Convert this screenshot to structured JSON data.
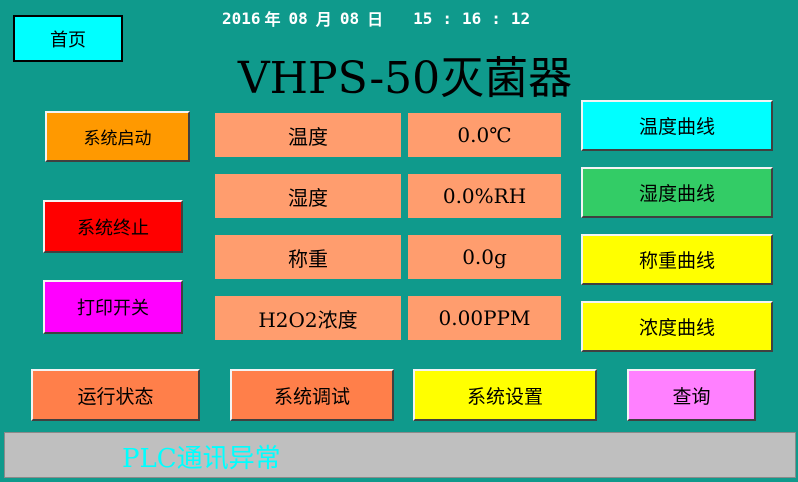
{
  "header": {
    "home_label": "首页",
    "date": {
      "year": "2016",
      "year_unit": "年",
      "month": "08",
      "month_unit": "月",
      "day": "08",
      "day_unit": "日"
    },
    "time": {
      "hour": "15",
      "minute": "16",
      "second": "12",
      "sep": ":"
    },
    "title": "VHPS-50灭菌器"
  },
  "left_controls": [
    {
      "label": "系统启动",
      "color": "#ff9900"
    },
    {
      "label": "系统终止",
      "color": "#ff0000"
    },
    {
      "label": "打印开关",
      "color": "#ff00ff"
    }
  ],
  "readings": [
    {
      "label": "温度",
      "value": "0.0℃"
    },
    {
      "label": "湿度",
      "value": "0.0%RH"
    },
    {
      "label": "称重",
      "value": "0.0g"
    },
    {
      "label": "H2O2浓度",
      "value": "0.00PPM"
    }
  ],
  "curve_buttons": [
    {
      "label": "温度曲线",
      "color": "#00ffff"
    },
    {
      "label": "湿度曲线",
      "color": "#33cc66"
    },
    {
      "label": "称重曲线",
      "color": "#ffff00"
    },
    {
      "label": "浓度曲线",
      "color": "#ffff00"
    }
  ],
  "bottom_nav": [
    {
      "label": "运行状态",
      "color": "#ff7f4a"
    },
    {
      "label": "系统调试",
      "color": "#ff7f4a"
    },
    {
      "label": "系统设置",
      "color": "#ffff00"
    },
    {
      "label": "查询",
      "color": "#ff80ff"
    }
  ],
  "status": {
    "message": "PLC通讯异常",
    "message_color": "#00ffff"
  },
  "colors": {
    "background": "#0f9a8c",
    "reading_cell": "#ff9d6e",
    "home_button": "#00ffff",
    "status_bar": "#bfbfbf"
  }
}
